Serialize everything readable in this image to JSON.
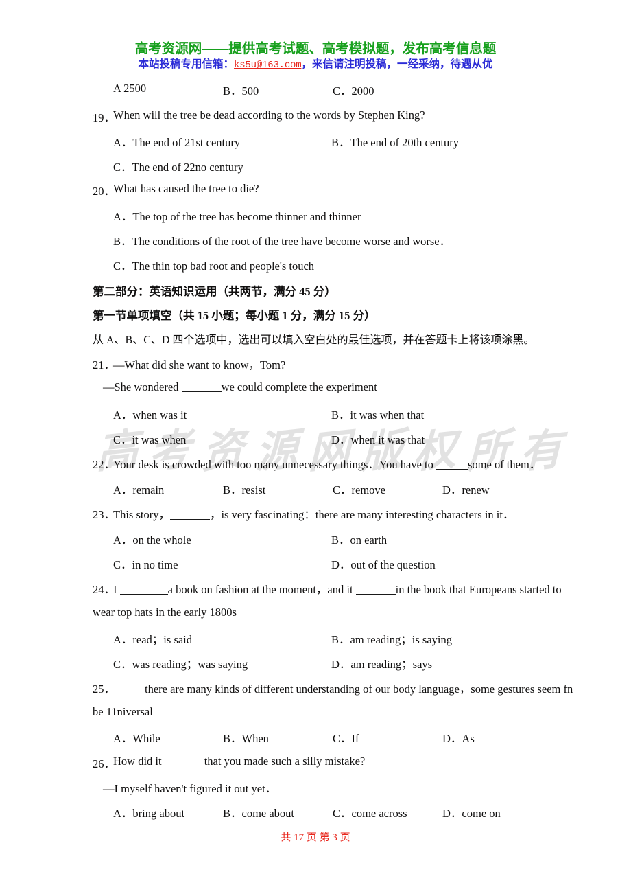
{
  "banner": {
    "line1_part1": "高考资源网——提供",
    "line1_part2": "高考试题",
    "line1_sep1": "、",
    "line1_part3": "高考模拟题",
    "line1_sep2": "，发布",
    "line1_part4": "高考信息题",
    "line2_prefix": "本站投稿专用信箱：",
    "line2_email": "ks5u@163.com",
    "line2_suffix": "，来信请注明投稿，一经采纳，待遇从优",
    "color_green": "#17a01d",
    "color_blue": "#2b2bd6",
    "color_red": "#e8261c"
  },
  "watermark": {
    "chars": [
      "高",
      "考",
      "资",
      "源",
      "网",
      "版",
      "权",
      "所",
      "有"
    ],
    "color": "#dedede"
  },
  "q18_options": {
    "a": "A 2500",
    "b": "B．500",
    "c": "C．2000"
  },
  "questions": [
    {
      "num": "19．",
      "stem": "When will the tree be dead according to the words by Stephen King?",
      "layout": "half",
      "options": [
        "A．The end of 21st century",
        "B．The end of 20th century",
        "C．The end of 22no century"
      ]
    },
    {
      "num": "20．",
      "stem": "What has caused the tree to die?",
      "layout": "stacked",
      "options": [
        "A．The top of the tree has become thinner and thinner",
        "B．The conditions of the root of the tree have become worse and worse．",
        "C．The thin top bad root and people's touch"
      ]
    },
    {
      "num": "21．",
      "stem_pre": "—What did she want to know，Tom?",
      "stem_cont_pre": "—She wondered ",
      "stem_cont_post": "we could complete the experiment",
      "layout": "half",
      "options": [
        "A．when was it",
        "B．it was when that",
        "C．it was when",
        "D．when it was that"
      ]
    },
    {
      "num": "22．",
      "stem_pre": "Your desk is crowded with too many unnecessary things．You have to ",
      "stem_post": "some of them．",
      "layout": "quad",
      "options": [
        "A．remain",
        "B．resist",
        "C．remove",
        "D．renew"
      ]
    },
    {
      "num": "23．",
      "stem_pre": "This story，",
      "stem_post": "，is very fascinating：there are many interesting characters in it．",
      "layout": "half",
      "options": [
        "A．on the whole",
        "B．on earth",
        "C．in no time",
        "D．out of the question"
      ]
    },
    {
      "num": "24．",
      "stem_pre": "I ",
      "stem_mid": "a book on fashion at the moment，and it ",
      "stem_post": "in the book that Europeans started to",
      "stem_line2": "wear top hats in the early 1800s",
      "layout": "half",
      "options": [
        "A．read；is said",
        "B．am reading；is saying",
        "C．was reading；was saying",
        "D．am reading；says"
      ]
    },
    {
      "num": "25．",
      "stem_pre": "",
      "stem_post": "there are many kinds of different understanding of our body language，some gestures seem fn",
      "stem_line2": "be 11niversal",
      "layout": "quad",
      "options": [
        "A．While",
        "B．When",
        "C．If",
        "D．As"
      ]
    },
    {
      "num": "26．",
      "stem_pre": "How did it ",
      "stem_post": "that you made such a silly mistake?",
      "stem_cont": "—I myself haven't figured it out yet．",
      "layout": "quad",
      "options": [
        "A．bring about",
        "B．come about",
        "C．come across",
        "D．come on"
      ]
    }
  ],
  "section": {
    "part_heading": "第二部分：英语知识运用（共两节，满分 45 分）",
    "sub_heading": "第一节单项填空（共 15 小题；每小题 1 分，满分 15 分）",
    "instruction": "从 A、B、C、D 四个选项中，选出可以填入空白处的最佳选项，并在答题卡上将该项涂黑。"
  },
  "footer": {
    "text": "共 17 页  第 3 页"
  }
}
